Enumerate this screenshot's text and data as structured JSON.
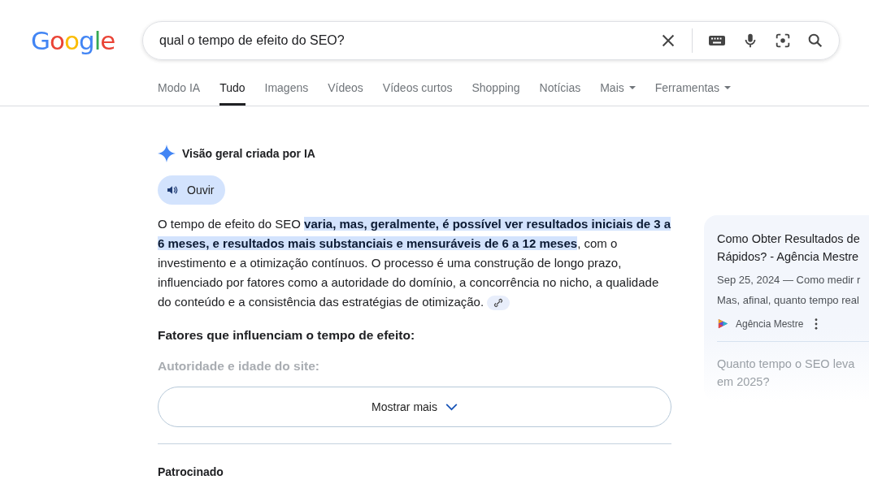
{
  "logo": "Google",
  "search": {
    "value": "qual o tempo de efeito do SEO?"
  },
  "tabs": [
    {
      "label": "Modo IA",
      "selected": false,
      "dropdown": false
    },
    {
      "label": "Tudo",
      "selected": true,
      "dropdown": false
    },
    {
      "label": "Imagens",
      "selected": false,
      "dropdown": false
    },
    {
      "label": "Vídeos",
      "selected": false,
      "dropdown": false
    },
    {
      "label": "Vídeos curtos",
      "selected": false,
      "dropdown": false
    },
    {
      "label": "Shopping",
      "selected": false,
      "dropdown": false
    },
    {
      "label": "Notícias",
      "selected": false,
      "dropdown": false
    },
    {
      "label": "Mais",
      "selected": false,
      "dropdown": true
    },
    {
      "label": "Ferramentas",
      "selected": false,
      "dropdown": true
    }
  ],
  "ai_overview": {
    "title": "Visão geral criada por IA",
    "listen_button": "Ouvir",
    "paragraph": "O tempo de efeito do SEO **varia, mas, geralmente, é possível ver resultados iniciais de 3 a 6 meses, e resultados mais substanciais e mensuráveis de 6 a 12 meses**, com o investimento e a otimização contínuos. O processo é uma construção de longo prazo, influenciado por fatores como a autoridade do domínio, a concorrência no nicho, a qualidade do conteúdo e a consistência das estratégias de otimização.",
    "heading": "Fatores que influenciam o tempo de efeito:",
    "faded_subheading": "Autoridade e idade do site:",
    "show_more": "Mostrar mais"
  },
  "sources": [
    {
      "title": "Como Obter Resultados de Rápidos? - Agência Mestre",
      "snippet_1": "Sep 25, 2024 — Como medir r",
      "snippet_2": "Mas, afinal, quanto tempo real",
      "site": "Agência Mestre",
      "faded": false
    },
    {
      "title": "Quanto tempo o SEO leva em 2025?",
      "faded": true
    }
  ],
  "sponsored_label": "Patrocinado"
}
